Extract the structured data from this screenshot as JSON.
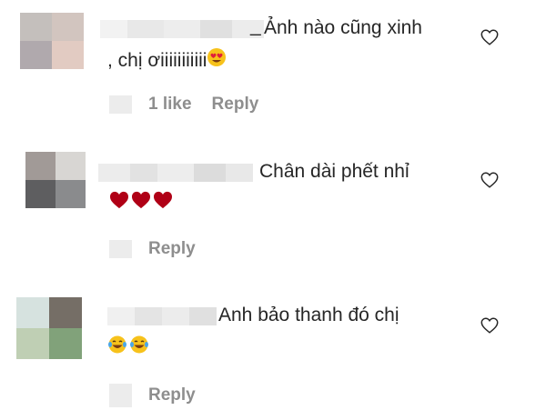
{
  "comments": [
    {
      "username_visible_part": "_",
      "text": "Ảnh nào cũng xinh",
      "text_line2": ", chị ơiiiiiiiiiii",
      "emoji": "smiling-face-with-heart-eyes",
      "likes_label": "1 like",
      "reply_label": "Reply"
    },
    {
      "text": "Chân dài phết nhỉ",
      "emoji": "red-hearts",
      "reply_label": "Reply"
    },
    {
      "text": "Anh bảo thanh đó chị",
      "emoji": "tears-of-joy",
      "reply_label": "Reply"
    }
  ],
  "colors": {
    "text": "#262626",
    "meta": "#8e8e8e",
    "heart": "#b00016",
    "emoji_yellow": "#f7c21b"
  }
}
